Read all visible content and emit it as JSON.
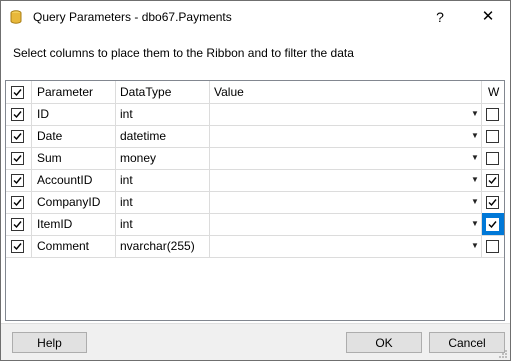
{
  "window": {
    "title": "Query Parameters - dbo67.Payments",
    "help_glyph": "?",
    "close_glyph": "✕",
    "instruction": "Select columns to place them to the Ribbon and to filter the data"
  },
  "grid": {
    "headers": {
      "parameter": "Parameter",
      "datatype": "DataType",
      "value": "Value",
      "w": "W"
    },
    "select_all_checked": true,
    "rows": [
      {
        "parameter": "ID",
        "datatype": "int",
        "value": "",
        "selected": true,
        "w": false
      },
      {
        "parameter": "Date",
        "datatype": "datetime",
        "value": "",
        "selected": true,
        "w": false
      },
      {
        "parameter": "Sum",
        "datatype": "money",
        "value": "",
        "selected": true,
        "w": false
      },
      {
        "parameter": "AccountID",
        "datatype": "int",
        "value": "",
        "selected": true,
        "w": true
      },
      {
        "parameter": "CompanyID",
        "datatype": "int",
        "value": "",
        "selected": true,
        "w": true
      },
      {
        "parameter": "ItemID",
        "datatype": "int",
        "value": "",
        "selected": true,
        "w": true,
        "focused": true
      },
      {
        "parameter": "Comment",
        "datatype": "nvarchar(255)",
        "value": "",
        "selected": true,
        "w": false
      }
    ]
  },
  "buttons": {
    "help": "Help",
    "ok": "OK",
    "cancel": "Cancel"
  },
  "colors": {
    "focus": "#0078d7",
    "app_icon": "#e8b83a",
    "button_face": "#e1e1e1"
  },
  "icons": {
    "app": "database-icon",
    "dropdown": "chevron-down-icon",
    "grip": "resize-grip-icon"
  }
}
